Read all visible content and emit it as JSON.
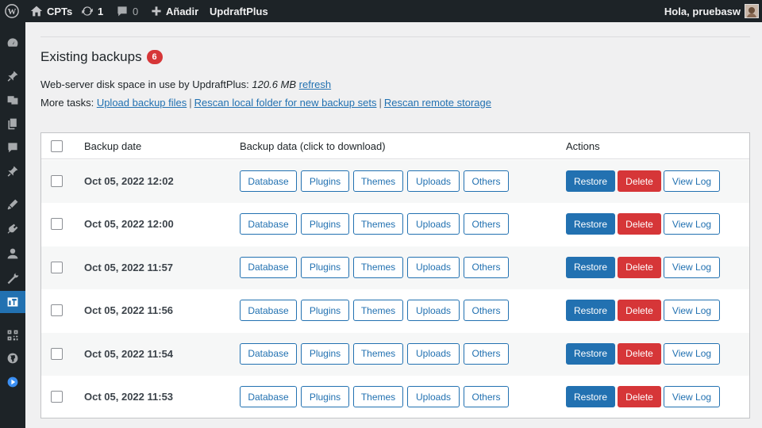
{
  "admin_bar": {
    "site_name": "CPTs",
    "updates_count": "1",
    "comments_count": "0",
    "new_label": "Añadir",
    "plugin_label": "UpdraftPlus",
    "greeting": "Hola, pruebasw"
  },
  "page": {
    "heading": "Existing backups",
    "backup_count": "6",
    "disk_label": "Web-server disk space in use by UpdraftPlus:",
    "disk_value": "120.6 MB",
    "refresh_link": "refresh",
    "more_tasks_label": "More tasks:",
    "task_links": [
      "Upload backup files",
      "Rescan local folder for new backup sets",
      "Rescan remote storage"
    ],
    "separator": "|"
  },
  "table": {
    "headers": {
      "date": "Backup date",
      "data": "Backup data (click to download)",
      "actions": "Actions"
    },
    "data_buttons": [
      "Database",
      "Plugins",
      "Themes",
      "Uploads",
      "Others"
    ],
    "action_buttons": {
      "restore": "Restore",
      "delete": "Delete",
      "view_log": "View Log"
    },
    "rows": [
      {
        "date": "Oct 05, 2022 12:02"
      },
      {
        "date": "Oct 05, 2022 12:00"
      },
      {
        "date": "Oct 05, 2022 11:57"
      },
      {
        "date": "Oct 05, 2022 11:56"
      },
      {
        "date": "Oct 05, 2022 11:54"
      },
      {
        "date": "Oct 05, 2022 11:53"
      }
    ]
  },
  "sidebar": {
    "icons": [
      "dashboard-icon",
      "pin-icon",
      "media-icon",
      "pages-icon",
      "comments-icon",
      "pin-icon",
      "appearance-icon",
      "plugins-icon",
      "users-icon",
      "tools-icon",
      "settings-icon",
      "qr-icon",
      "globe-icon",
      "play-icon"
    ],
    "current_index": 10
  },
  "colors": {
    "admin_bar_bg": "#1d2327",
    "accent": "#2271b1",
    "danger": "#d63638",
    "page_bg": "#f0f0f1"
  }
}
